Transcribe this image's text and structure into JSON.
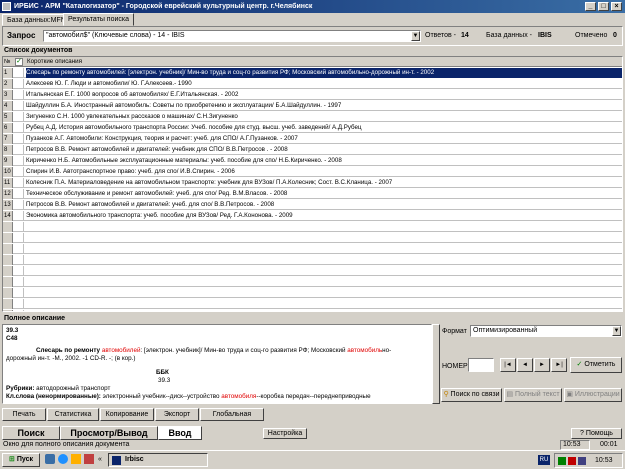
{
  "window": {
    "title": "ИРБИС - АРМ \"Каталогизатор\" - Городской еврейский культурный центр. г.Челябинск",
    "minimize": "_",
    "maximize": "□",
    "close": "×"
  },
  "top_tabs": [
    "База данных:MFN",
    "Результаты поиска"
  ],
  "query": {
    "label": "Запрос",
    "value": "\"автомобил$\" (Ключевые слова) - 14 - IBIS",
    "answers_label": "Ответов -",
    "answers_count": "14",
    "db_label": "База данных -",
    "db_value": "IBIS",
    "marked_label": "Отмечено",
    "marked_count": "0"
  },
  "doc_list": {
    "title": "Список документов",
    "header_num": "№",
    "header_text": "Короткие описания",
    "rows": [
      {
        "n": "1",
        "text": "Слесарь по ремонту автомобилей:   [электрон. учебник]/ Мин-во труда и соц-го развития РФ; Московский автомобильно-дорожный ин-т. - 2002"
      },
      {
        "n": "2",
        "text": "Алексеев Ю. Г. Люди и автомобили/ Ю. Г.Алексеев.- 1990"
      },
      {
        "n": "3",
        "text": "Итальянская Е.Г. 1000 вопросов об автомобилях/ Е.Г.Итальянская. - 2002"
      },
      {
        "n": "4",
        "text": "Шайдуллин Б.А. Иностранный автомобиль: Советы по приобретению и эксплуатации/ Б.А.Шайдуллин. - 1997"
      },
      {
        "n": "5",
        "text": "Зигуненко С.Н. 1000 увлекательных рассказов о машинах/ С.Н.Зигуненко"
      },
      {
        "n": "6",
        "text": "Рубец А.Д. История автомобильного транспорта России: Учеб. пособие для студ. высш. учеб. заведений/ А.Д.Рубец"
      },
      {
        "n": "7",
        "text": "Пузанков А.Г. Автомобили: Конструкция, теория и расчет: учеб. для СПО/ А.Г.Пузанков. - 2007"
      },
      {
        "n": "8",
        "text": "Петросов В.В. Ремонт автомобилей и двигателей: учебник для СПО/ В.В.Петросов . - 2008"
      },
      {
        "n": "9",
        "text": "Кириченко Н.Б. Автомобильные эксплуатационные материалы: учеб. пособие для спо/ Н.Б.Кириченко. - 2008"
      },
      {
        "n": "10",
        "text": "Спирин И.В. Автотранспортное право: учеб. для спо/ И.В.Спирин. - 2006"
      },
      {
        "n": "11",
        "text": "Колесник П.А. Материаловедение на автомобильном транспорте: учебник для ВУЗов/ П.А.Колесник; Сост. В.С.Кланица. - 2007"
      },
      {
        "n": "12",
        "text": "Техническое обслуживание и ремонт автомобилей: учеб. для спо/ Ред. В.М.Власов. - 2008"
      },
      {
        "n": "13",
        "text": "Петросов В.В. Ремонт автомобилей и двигателей: учеб. для спо/ В.В.Петросов. - 2008"
      },
      {
        "n": "14",
        "text": "Экономика автомобильного транспорта: учеб. пособие для ВУЗов/ Ред. Г.А.Кононова. - 2009"
      }
    ]
  },
  "full_desc": {
    "title": "Полное описание",
    "code1": "39.3",
    "code2": "С48",
    "main_before": "Слесарь по ремонту ",
    "main_red1": "автомобилей",
    "main_mid": ":   [электрон. учебник]/ Мин-во труда и соц-го развития РФ; Московский ",
    "main_red2": "автомобиль",
    "main_after": "но-",
    "line2": "дорожный ин-т. -М., 2002. -1 CD-R. -; (в кор.)",
    "bbk_label": "ББК",
    "bbk_value": "39.3",
    "rubrics_label": "Рубрики:",
    "rubrics_value": " автодорожный транспорт",
    "keywords_label": "Кл.слова (ненормированные):",
    "kw_before": " электронный учебник--диск--устройство ",
    "kw_red": "автомобиля",
    "kw_after": "--коробка передач--переднеприводные"
  },
  "format": {
    "label": "Формат",
    "value": "Оптимизированный",
    "number_label": "НОМЕР",
    "number_value": "",
    "nav_first": "|◄",
    "nav_prev": "◄",
    "nav_next": "►",
    "nav_last": "►|",
    "mark_button": "Отметить",
    "link_search": "Поиск по связи",
    "full_text": "Полный текст",
    "illustrations": "Иллюстрации"
  },
  "bottom_tabs": [
    "Печать",
    "Статистика",
    "Копирование",
    "Экспорт",
    "Глобальная"
  ],
  "mode_tabs": [
    "Поиск",
    "Просмотр/Вывод",
    "Ввод"
  ],
  "settings_button": "Настройка",
  "help_button": "Помощь",
  "status": {
    "text": "Окно для полного описания документа",
    "time1": "10:53",
    "time2": "00:01"
  },
  "taskbar": {
    "start": "Пуск",
    "app": "Irbisc",
    "lang": "RU",
    "clock": "10:53"
  },
  "colors": {
    "titlebar": "#0a246a",
    "selection": "#0a246a",
    "highlight": "#e00000",
    "face": "#d4d0c8"
  }
}
